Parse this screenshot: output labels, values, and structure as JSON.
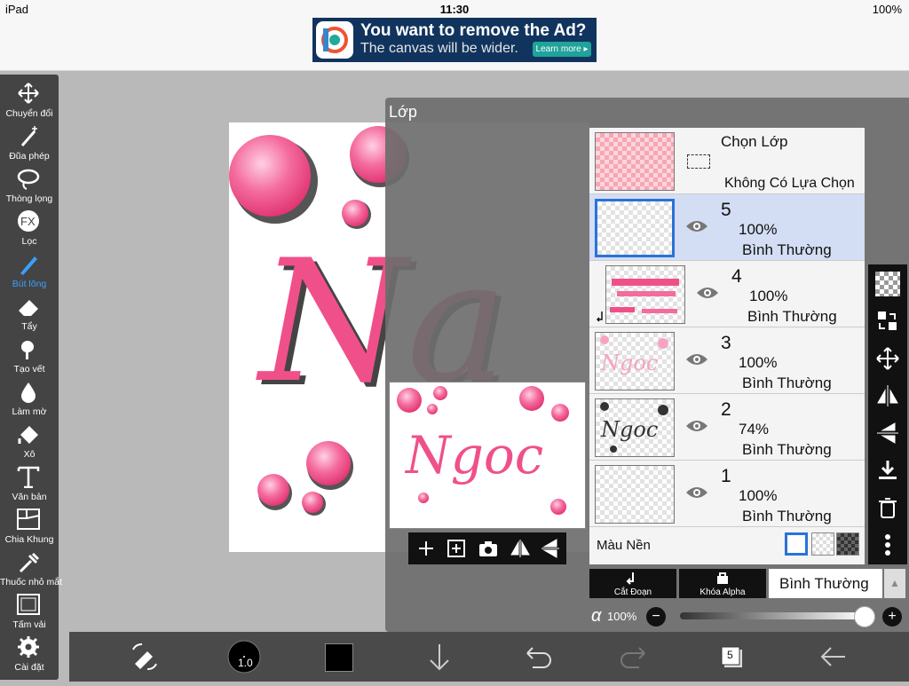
{
  "status": {
    "device": "iPad",
    "time": "11:30",
    "battery": "100%"
  },
  "ad": {
    "title": "You want to remove the Ad?",
    "subtitle": "The canvas will be wider.",
    "button": "Learn more ▸"
  },
  "tools": [
    {
      "label": "Chuyển đổi",
      "icon": "move-icon"
    },
    {
      "label": "Đũa phép",
      "icon": "magic-wand-icon"
    },
    {
      "label": "Thòng lọng",
      "icon": "lasso-icon"
    },
    {
      "label": "Lọc",
      "icon": "fx-filter-icon"
    },
    {
      "label": "Bút lông",
      "icon": "brush-icon",
      "active": true
    },
    {
      "label": "Tẩy",
      "icon": "eraser-icon"
    },
    {
      "label": "Tạo vết",
      "icon": "smudge-icon"
    },
    {
      "label": "Làm mờ",
      "icon": "blur-drop-icon"
    },
    {
      "label": "Xô",
      "icon": "bucket-icon"
    },
    {
      "label": "Văn bản",
      "icon": "text-icon"
    },
    {
      "label": "Chia Khung",
      "icon": "frame-divider-icon"
    },
    {
      "label": "Thuốc nhỏ mắt",
      "icon": "eyedropper-icon"
    },
    {
      "label": "Tấm vải",
      "icon": "canvas-icon"
    },
    {
      "label": "Cài đặt",
      "icon": "settings-gear-icon"
    }
  ],
  "panel": {
    "title": "Lớp"
  },
  "selection_layer": {
    "label": "Chọn Lớp",
    "status": "Không Có Lựa Chọn"
  },
  "layers": [
    {
      "number": "5",
      "opacity": "100%",
      "mode": "Bình Thường",
      "selected": true
    },
    {
      "number": "4",
      "opacity": "100%",
      "mode": "Bình Thường"
    },
    {
      "number": "3",
      "opacity": "100%",
      "mode": "Bình Thường"
    },
    {
      "number": "2",
      "opacity": "74%",
      "mode": "Bình Thường"
    },
    {
      "number": "1",
      "opacity": "100%",
      "mode": "Bình Thường"
    }
  ],
  "background": {
    "label": "Màu Nền"
  },
  "controls": {
    "clip": "Cắt Đoạn",
    "alpha_lock": "Khóa Alpha",
    "blend": "Bình Thường",
    "alpha_symbol": "α",
    "alpha_value": "100%",
    "alpha_fraction": 1.0
  },
  "bottom": {
    "brush_size": "1.0",
    "layer_count": "5",
    "color": "#000000"
  },
  "preview_text": "Ngoc",
  "canvas_text": "Na",
  "colors": {
    "accent": "#2a72d8",
    "pink": "#f0508a",
    "toolbar": "#444444"
  }
}
